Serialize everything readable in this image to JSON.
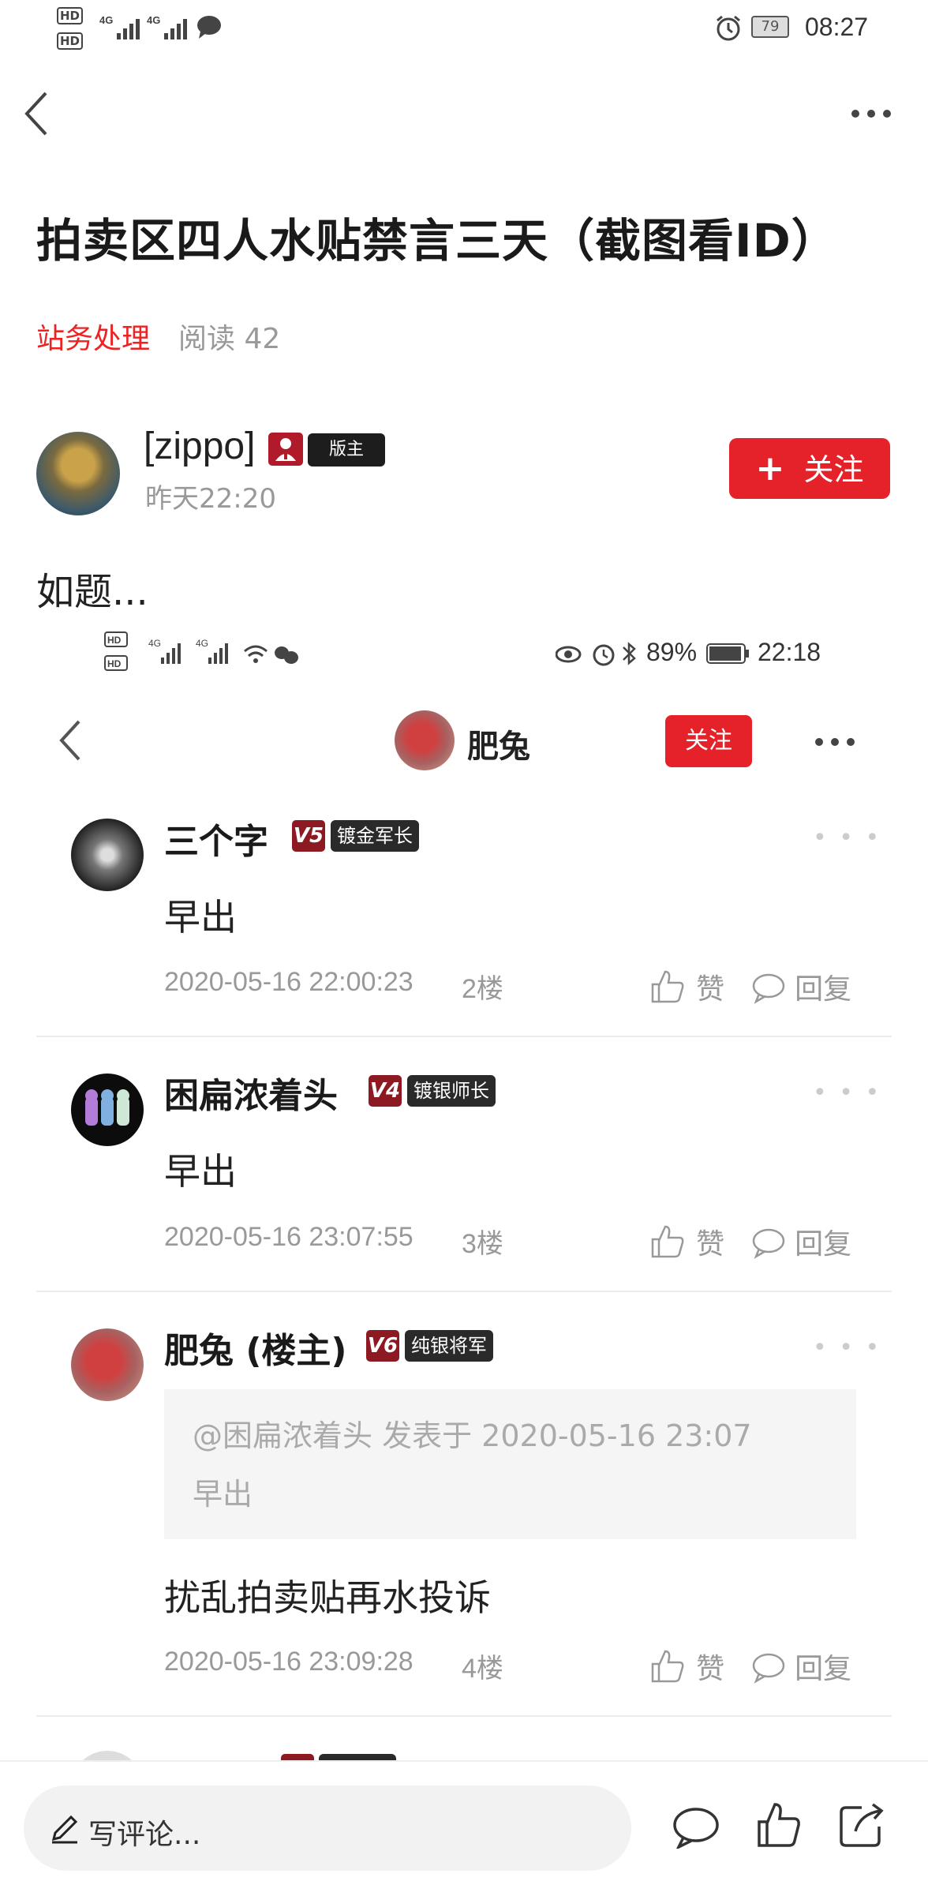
{
  "status_bar": {
    "network_1": "4G",
    "network_2": "4G",
    "battery": "79",
    "time": "08:27",
    "hd1": "HD",
    "hd2": "HD"
  },
  "nav": {
    "back_icon": "chevron-left-icon",
    "more_icon": "more-icon"
  },
  "post": {
    "title": "拍卖区四人水贴禁言三天（截图看ID）",
    "category": "站务处理",
    "reads": "阅读 42",
    "author": {
      "name": "[zippo]",
      "badge": "版主",
      "time": "昨天22:20"
    },
    "follow_button": "关注",
    "body": "如题..."
  },
  "embedded": {
    "status": {
      "battery": "89%",
      "time": "22:18"
    },
    "header": {
      "name": "肥兔",
      "follow": "关注"
    },
    "comments": [
      {
        "name": "三个字",
        "level": "V5",
        "rank": "镀金军长",
        "text": "早出",
        "date": "2020-05-16 22:00:23",
        "floor": "2楼",
        "like": "赞",
        "reply": "回复"
      },
      {
        "name": "困扁浓着头",
        "level": "V4",
        "rank": "镀银师长",
        "text": "早出",
        "date": "2020-05-16 23:07:55",
        "floor": "3楼",
        "like": "赞",
        "reply": "回复"
      },
      {
        "name": "肥兔 (楼主)",
        "level": "V6",
        "rank": "纯银将军",
        "quote_header": "@困扁浓着头 发表于 2020-05-16 23:07",
        "quote_text": "早出",
        "text": "扰乱拍卖贴再水投诉",
        "date": "2020-05-16 23:09:28",
        "floor": "4楼",
        "like": "赞",
        "reply": "回复"
      }
    ]
  },
  "bottom_bar": {
    "placeholder": "写评论..."
  },
  "colors": {
    "accent": "#e5222a",
    "level_badge": "#8d1a22",
    "muted": "#999999"
  }
}
